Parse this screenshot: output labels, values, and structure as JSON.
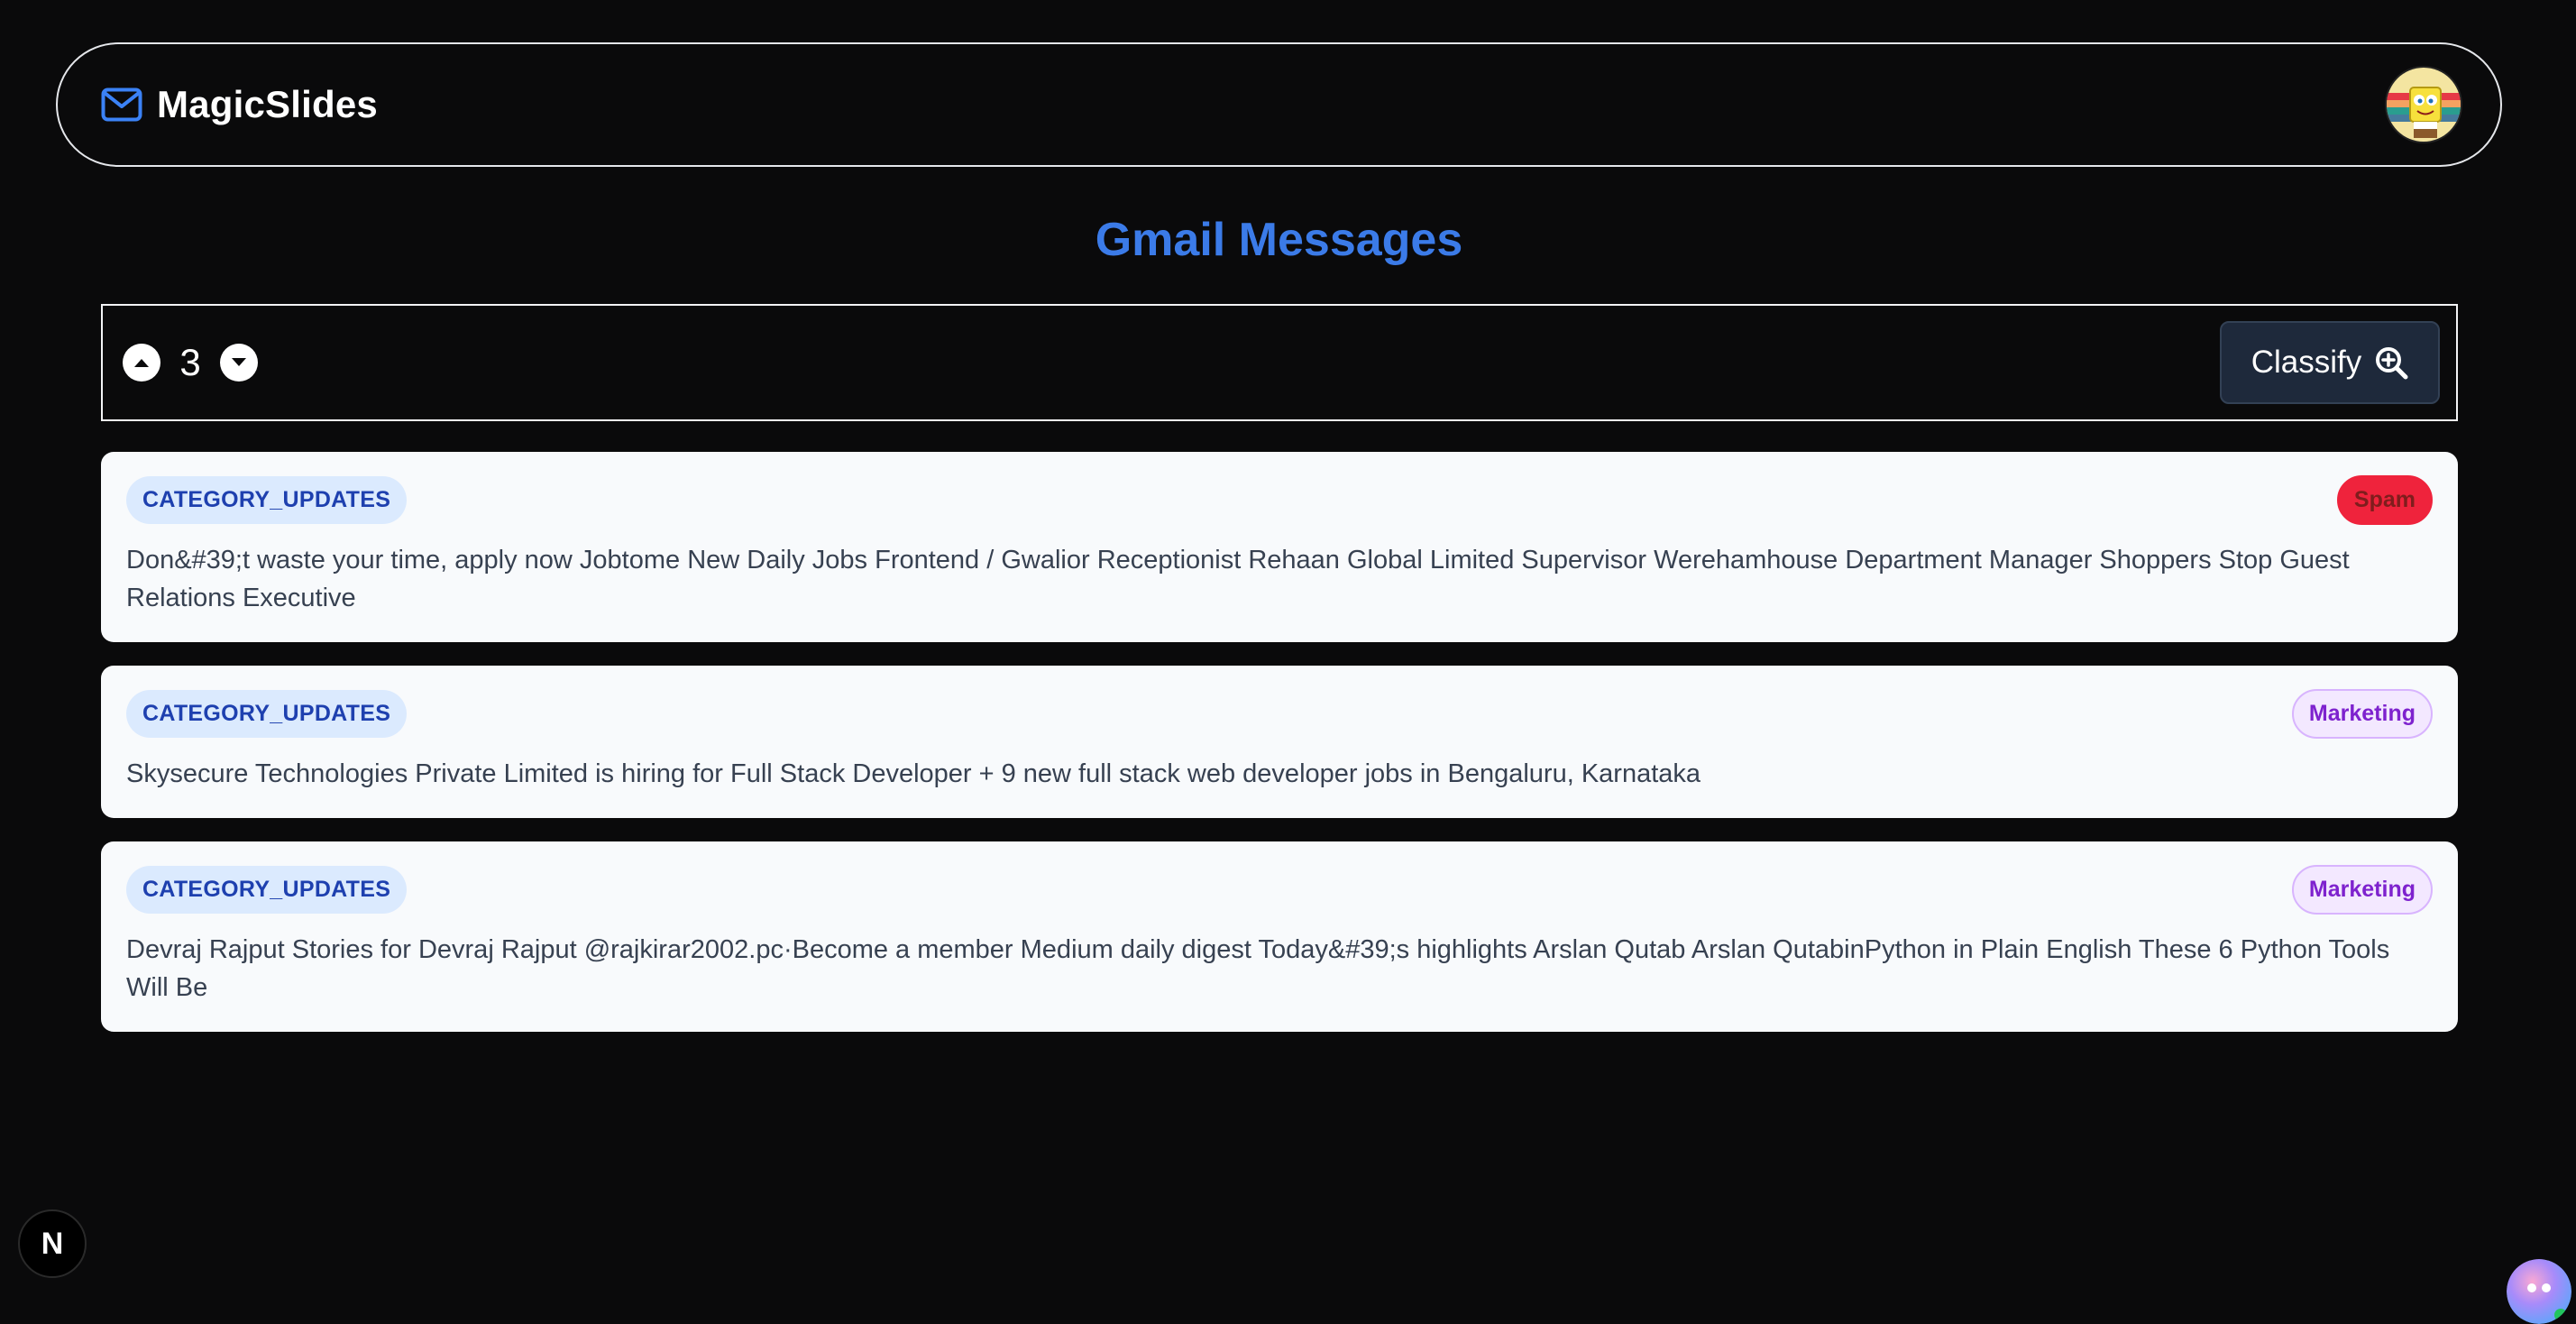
{
  "header": {
    "brand_name": "MagicSlides",
    "brand_icon": "mail-icon",
    "avatar_icon": "user-avatar"
  },
  "page": {
    "title": "Gmail Messages"
  },
  "controls": {
    "count_value": "3",
    "increase_icon": "caret-up-icon",
    "decrease_icon": "caret-down-icon",
    "classify_label": "Classify",
    "classify_icon": "zoom-in-icon"
  },
  "messages": [
    {
      "category": "CATEGORY_UPDATES",
      "label": "Spam",
      "label_color": "#ef233c",
      "snippet": "Don&#39;t waste your time, apply now Jobtome New Daily Jobs Frontend / Gwalior Receptionist Rehaan Global Limited Supervisor Werehamhouse Department Manager Shoppers Stop Guest Relations Executive"
    },
    {
      "category": "CATEGORY_UPDATES",
      "label": "Marketing",
      "label_color": "#7e22ce",
      "snippet": "Skysecure Technologies Private Limited is hiring for Full Stack Developer + 9 new full stack web developer jobs in Bengaluru, Karnataka"
    },
    {
      "category": "CATEGORY_UPDATES",
      "label": "Marketing",
      "label_color": "#7e22ce",
      "snippet": "Devraj Rajput Stories for Devraj Rajput @rajkirar2002.pc·Become a member Medium daily digest Today&#39;s highlights Arslan Qutab Arslan QutabinPython in Plain English These 6 Python Tools Will Be"
    }
  ],
  "overlay": {
    "dev_badge_letter": "N"
  },
  "colors": {
    "background": "#0a0a0b",
    "accent": "#3b7be8",
    "card": "#f8fafc",
    "category_badge_bg": "#dbeafe",
    "category_badge_text": "#1e40af"
  }
}
